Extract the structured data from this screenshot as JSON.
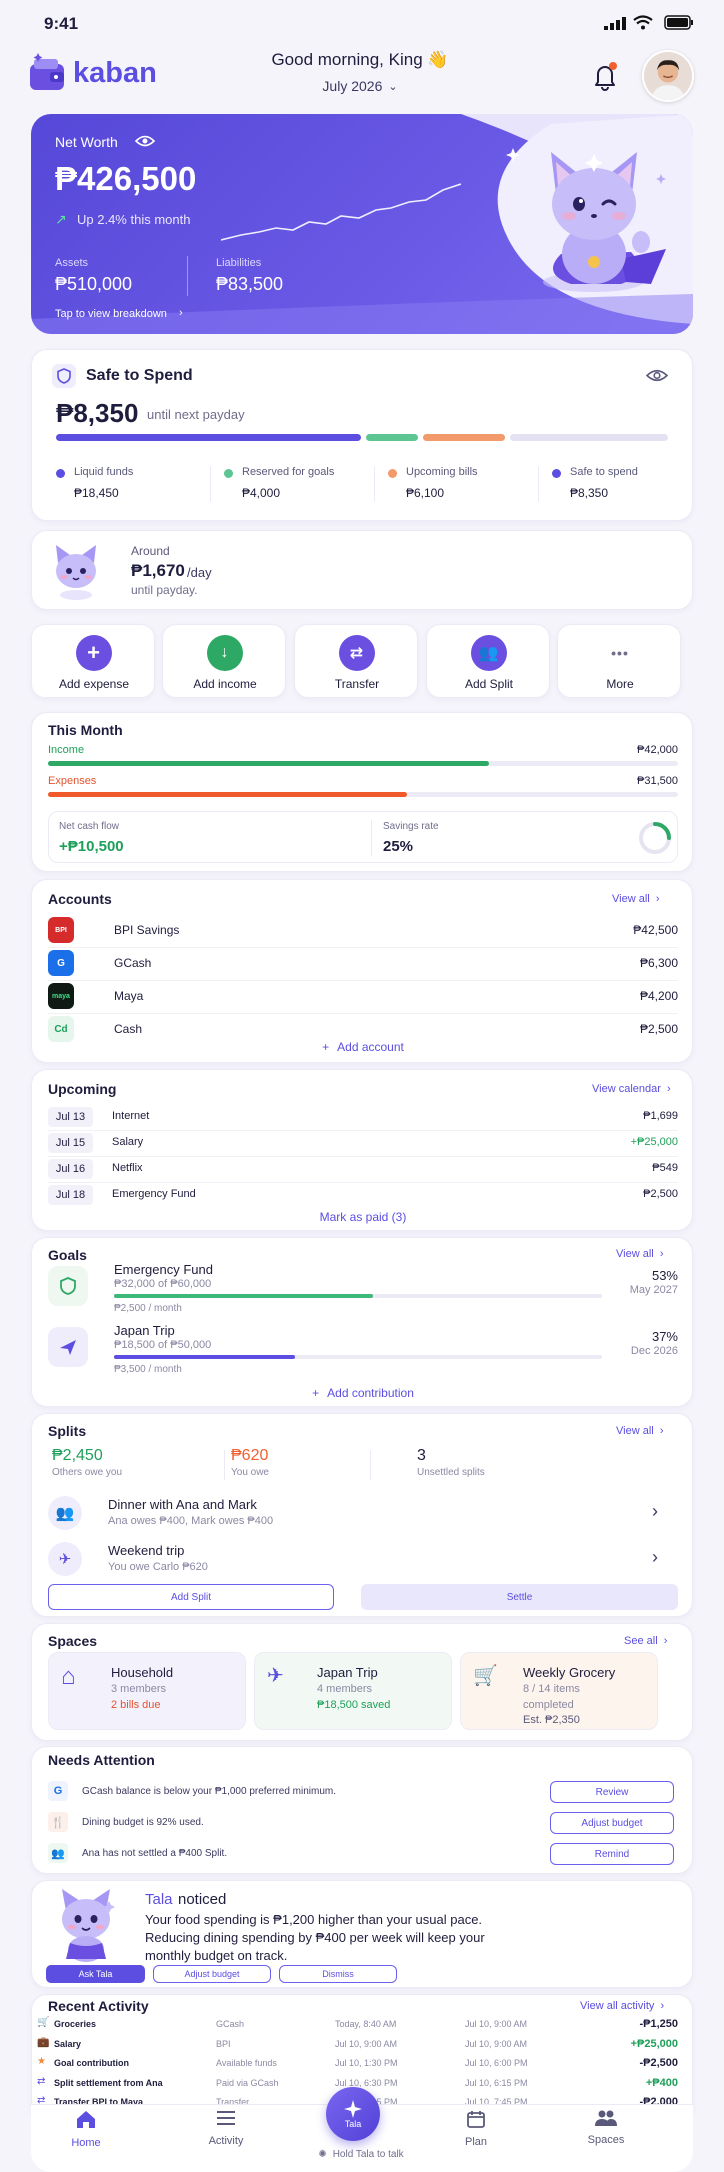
{
  "status": {
    "time": "9:41"
  },
  "header": {
    "brand": "kaban",
    "greeting": "Good morning, King 👋",
    "month": "July 2026"
  },
  "net_worth": {
    "label": "Net Worth",
    "value": "₱426,500",
    "change": "Up 2.4% this month",
    "assets_label": "Assets",
    "assets": "₱510,000",
    "liabilities_label": "Liabilities",
    "liabilities": "₱83,500",
    "breakdown_link": "Tap to view breakdown"
  },
  "safe": {
    "title": "Safe to Spend",
    "amount": "₱8,350",
    "sub": "until next payday",
    "items": [
      {
        "label": "Liquid funds",
        "value": "₱18,450",
        "color": "#5b4ee0"
      },
      {
        "label": "Reserved for goals",
        "value": "₱4,000",
        "color": "#5cc592"
      },
      {
        "label": "Upcoming bills",
        "value": "₱6,100",
        "color": "#f39a6b"
      },
      {
        "label": "Safe to spend",
        "value": "₱8,350",
        "color": "#5b4ee0"
      }
    ]
  },
  "daily": {
    "around": "Around",
    "amount": "₱1,670",
    "unit": "/day",
    "until": "until payday."
  },
  "quick_actions": [
    {
      "label": "Add expense",
      "color": "#6b4fe0",
      "icon": "plus-icon",
      "glyph": "+"
    },
    {
      "label": "Add income",
      "color": "#2ea965",
      "icon": "arrow-down-icon",
      "glyph": "↓"
    },
    {
      "label": "Transfer",
      "color": "#6b4fe0",
      "icon": "transfer-icon",
      "glyph": "⇄"
    },
    {
      "label": "Add Split",
      "color": "#6b4fe0",
      "icon": "people-icon",
      "glyph": "👥"
    },
    {
      "label": "More",
      "color": "#ffffff",
      "icon": "more-icon",
      "glyph": "•••"
    }
  ],
  "this_month": {
    "title": "This Month",
    "income_label": "Income",
    "income": "₱42,000",
    "income_pct": 0.7,
    "expenses_label": "Expenses",
    "expenses": "₱31,500",
    "expenses_pct": 0.57,
    "cash_flow_label": "Net cash flow",
    "cash_flow": "+₱10,500",
    "savings_label": "Savings rate",
    "savings": "25%",
    "savings_pct": 0.25
  },
  "accounts": {
    "title": "Accounts",
    "view_all": "View all",
    "items": [
      {
        "name": "BPI Savings",
        "balance": "₱42,500",
        "logo": "BPI",
        "bg": "#d62b2b",
        "fg": "#ffffff"
      },
      {
        "name": "GCash",
        "balance": "₱6,300",
        "logo": "G",
        "bg": "#1b6fe8",
        "fg": "#ffffff"
      },
      {
        "name": "Maya",
        "balance": "₱4,200",
        "logo": "maya",
        "bg": "#0f1a14",
        "fg": "#3fe08a"
      },
      {
        "name": "Cash",
        "balance": "₱2,500",
        "logo": "Cd",
        "bg": "#e6f6ec",
        "fg": "#1fa05a"
      }
    ],
    "add_account": "Add account"
  },
  "upcoming": {
    "title": "Upcoming",
    "view_calendar": "View calendar",
    "items": [
      {
        "date": "Jul 13",
        "name": "Internet",
        "amount": "₱1,699",
        "positive": false
      },
      {
        "date": "Jul 15",
        "name": "Salary",
        "amount": "+₱25,000",
        "positive": true
      },
      {
        "date": "Jul 16",
        "name": "Netflix",
        "amount": "₱549",
        "positive": false
      },
      {
        "date": "Jul 18",
        "name": "Emergency Fund",
        "amount": "₱2,500",
        "positive": false
      }
    ],
    "mark_paid": "Mark as paid (3)"
  },
  "goals": {
    "title": "Goals",
    "view_all": "View all",
    "items": [
      {
        "name": "Emergency Fund",
        "progress": "₱32,000 of ₱60,000",
        "monthly": "₱2,500 / month",
        "pct": "53%",
        "pct_value": 0.53,
        "date": "May 2027",
        "color": "#3cb878"
      },
      {
        "name": "Japan Trip",
        "progress": "₱18,500 of ₱50,000",
        "monthly": "₱3,500 / month",
        "pct": "37%",
        "pct_value": 0.37,
        "date": "Dec 2026",
        "color": "#5b4ee0"
      }
    ],
    "add_contribution": "Add contribution"
  },
  "splits": {
    "title": "Splits",
    "view_all": "View all",
    "others_owe": "₱2,450",
    "others_owe_label": "Others owe you",
    "you_owe": "₱620",
    "you_owe_label": "You owe",
    "unsettled": "3",
    "unsettled_label": "Unsettled splits",
    "items": [
      {
        "title": "Dinner with Ana and Mark",
        "sub": "Ana owes ₱400, Mark owes ₱400"
      },
      {
        "title": "Weekend trip",
        "sub": "You owe Carlo ₱620"
      }
    ],
    "add_split": "Add Split",
    "settle": "Settle"
  },
  "spaces": {
    "title": "Spaces",
    "see_all": "See all",
    "items": [
      {
        "name": "Household",
        "line1": "3 members",
        "line2": "2 bills due",
        "line3": "",
        "bg": "#f3f2fc"
      },
      {
        "name": "Japan Trip",
        "line1": "4 members",
        "line2": "₱18,500 saved",
        "line3": "",
        "bg": "#f2f9f4"
      },
      {
        "name": "Weekly Grocery",
        "line1": "8 / 14 items",
        "line2": "completed",
        "line3": "Est. ₱2,350",
        "bg": "#fdf4ee"
      }
    ]
  },
  "attention": {
    "title": "Needs Attention",
    "items": [
      {
        "text": "GCash balance is below your ₱1,000 preferred minimum.",
        "action": "Review"
      },
      {
        "text": "Dining budget is 92% used.",
        "action": "Adjust budget"
      },
      {
        "text": "Ana has not settled a ₱400 Split.",
        "action": "Remind"
      }
    ]
  },
  "tala": {
    "name": "Tala",
    "noticed": "noticed",
    "message": "Your food spending is ₱1,200 higher than your usual pace. Reducing dining spending by ₱400 per week will keep your monthly budget on track.",
    "ask": "Ask Tala",
    "adjust": "Adjust budget",
    "dismiss": "Dismiss"
  },
  "activity": {
    "title": "Recent Activity",
    "view_all": "View all activity",
    "items": [
      {
        "name": "Groceries",
        "source": "GCash",
        "time": "Today, 8:40 AM",
        "date": "Jul 10, 9:00 AM",
        "amount": "-₱1,250",
        "positive": false,
        "color": "#5b4ee0"
      },
      {
        "name": "Salary",
        "source": "BPI",
        "time": "Jul 10, 9:00 AM",
        "date": "Jul 10, 9:00 AM",
        "amount": "+₱25,000",
        "positive": true,
        "color": "#1fa05a"
      },
      {
        "name": "Goal contribution",
        "source": "Available funds",
        "time": "Jul 10, 1:30 PM",
        "date": "Jul 10, 6:00 PM",
        "amount": "-₱2,500",
        "positive": false,
        "color": "#f08a3c"
      },
      {
        "name": "Split settlement from Ana",
        "source": "Paid via GCash",
        "time": "Jul 10, 6:30 PM",
        "date": "Jul 10, 6:15 PM",
        "amount": "+₱400",
        "positive": true,
        "color": "#5b4ee0"
      },
      {
        "name": "Transfer BPI to Maya",
        "source": "Transfer",
        "time": "Jul 10, 7:15 PM",
        "date": "Jul 10, 7:45 PM",
        "amount": "-₱2,000",
        "positive": false,
        "color": "#5b4ee0"
      }
    ]
  },
  "nav": {
    "home": "Home",
    "activity": "Activity",
    "tala": "Tala",
    "plan": "Plan",
    "spaces": "Spaces",
    "hold": "Hold Tala to talk"
  }
}
